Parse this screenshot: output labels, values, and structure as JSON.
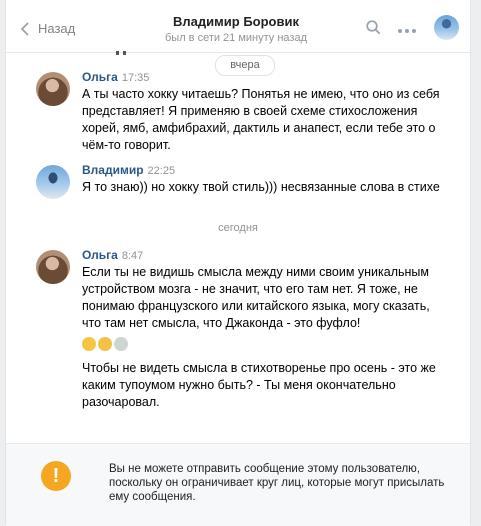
{
  "header": {
    "back_label": "Назад",
    "title": "Владимир Боровик",
    "status": "был в сети 21 минуту назад"
  },
  "dates": {
    "yesterday": "вчера",
    "today": "сегодня"
  },
  "messages": [
    {
      "sender": "Ольга",
      "time": "17:35",
      "text": "А ты часто хокку читаешь? Понятья не имею, что оно из себя представляет! Я применяю в своей схеме стихосложения хорей, ямб, амфибрахий, дактиль и анапест, если тебе это о чём-то говорит."
    },
    {
      "sender": "Владимир",
      "time": "22:25",
      "text": "Я то знаю)) но хокку твой стиль))) несвязанные слова в стихе"
    },
    {
      "sender": "Ольга",
      "time": "8:47",
      "text": "Если ты не видишь смысла между ними своим уникальным устройством мозга - не значит, что его там нет. Я тоже, не понимаю французского или китайского языка, могу сказать, что там нет смысла, что Джаконда - это фуфло!",
      "emoji": [
        "rolling-laughing-emoji",
        "sleeping-emoji",
        "alien-emoji"
      ],
      "text2": "Чтобы не видеть смысла в стихотворенье про осень - это же каким тупоумом нужно быть? - Ты меня окончательно разочаровал."
    }
  ],
  "notice": {
    "text": "Вы не можете отправить сообщение этому пользователю, поскольку он ограничивает круг лиц, которые могут присылать ему сообщения.",
    "icon": "exclamation-icon",
    "icon_color": "#f5a623"
  },
  "colors": {
    "link": "#2a5885",
    "muted": "#939393",
    "background": "#edeef0"
  }
}
